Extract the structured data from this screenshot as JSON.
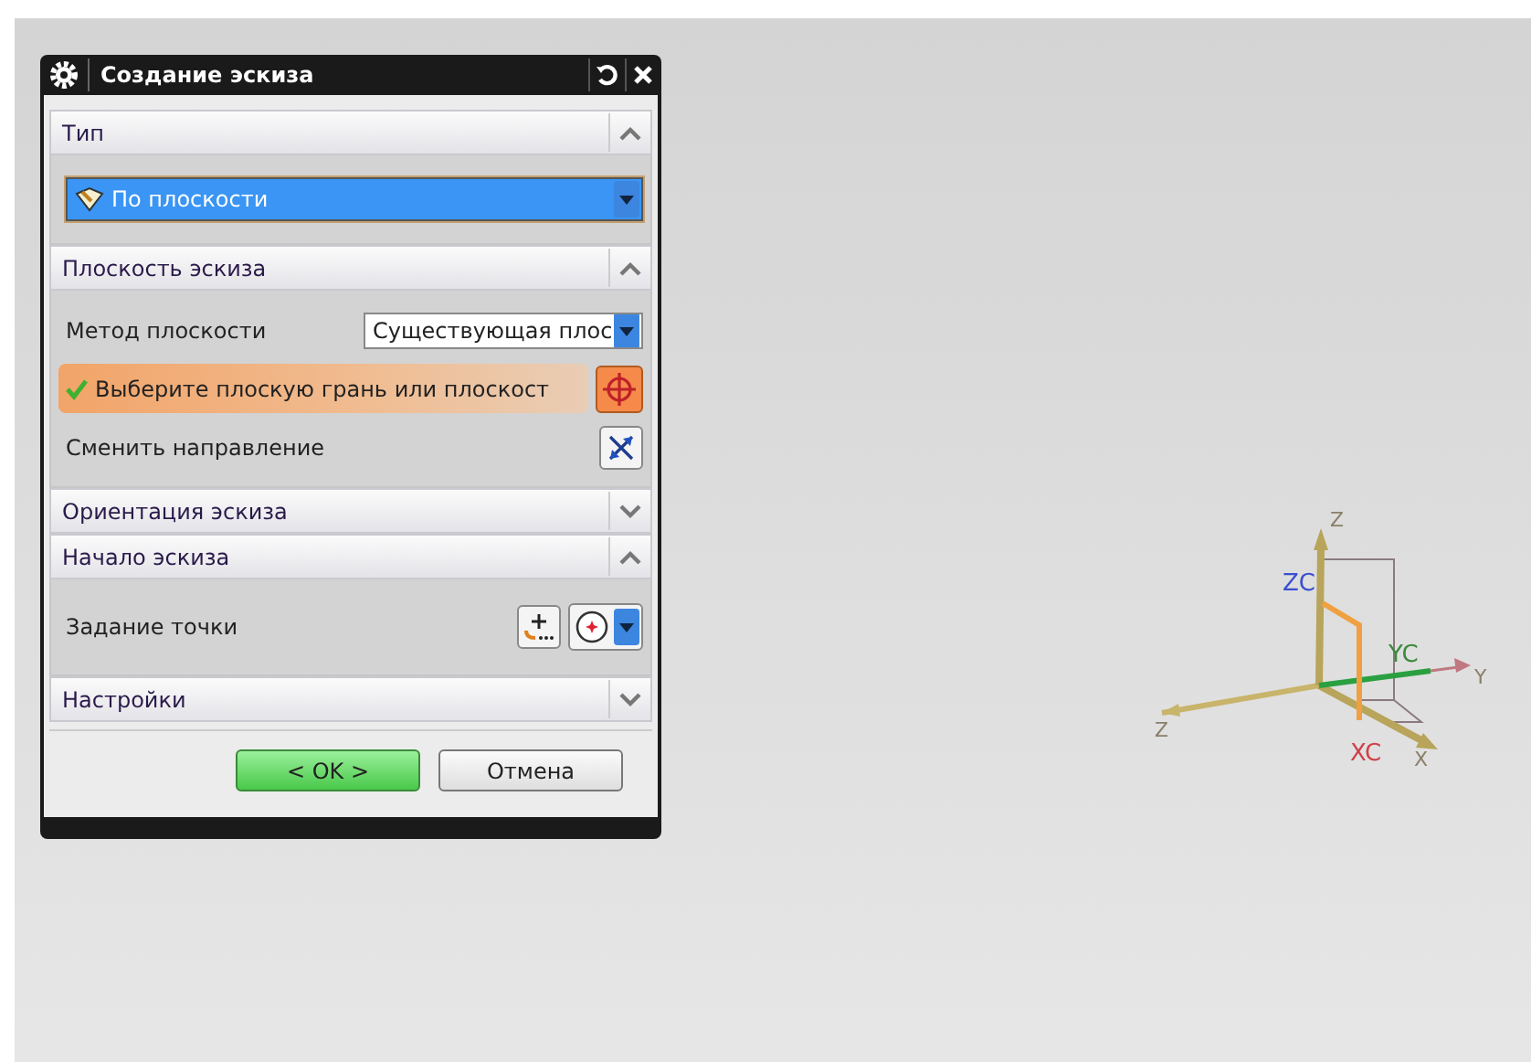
{
  "dialog": {
    "title": "Создание эскиза",
    "sections": [
      {
        "title": "Тип",
        "expanded": true,
        "rows": [
          {
            "kind": "dropdown",
            "value": "По плоскости"
          }
        ]
      },
      {
        "title": "Плоскость эскиза",
        "expanded": true,
        "rows": [
          {
            "kind": "select",
            "label": "Метод плоскости",
            "value": "Существующая плос"
          },
          {
            "kind": "selection",
            "label": "Выберите плоскую грань или плоскост"
          },
          {
            "kind": "toggle",
            "label": "Сменить направление"
          }
        ]
      },
      {
        "title": "Ориентация эскиза",
        "expanded": false
      },
      {
        "title": "Начало эскиза",
        "expanded": true,
        "rows": [
          {
            "kind": "point",
            "label": "Задание точки"
          }
        ]
      },
      {
        "title": "Настройки",
        "expanded": false
      }
    ],
    "buttons": [
      {
        "label": "< OK >",
        "default": true
      },
      {
        "label": "Отмена",
        "default": false
      }
    ]
  },
  "triad": {
    "labels": [
      {
        "text": "Z",
        "color": "#8a7f6a"
      },
      {
        "text": "ZC",
        "color": "#3b4fd0"
      },
      {
        "text": "YC",
        "color": "#3c8a3c"
      },
      {
        "text": "Y",
        "color": "#8a7f6a"
      },
      {
        "text": "Z",
        "color": "#8a7f6a"
      },
      {
        "text": "XC",
        "color": "#d0404a"
      },
      {
        "text": "X",
        "color": "#8a7f6a"
      }
    ]
  }
}
